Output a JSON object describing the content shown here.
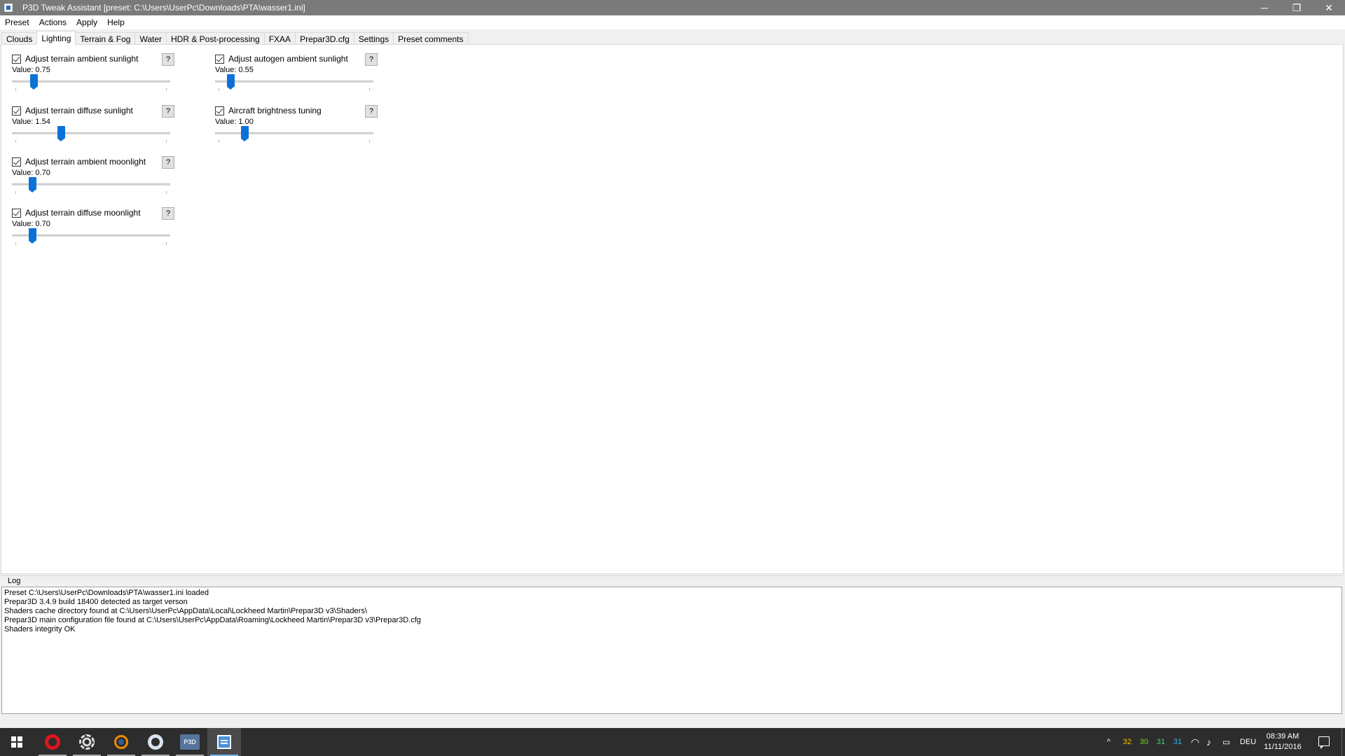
{
  "window": {
    "title": "P3D Tweak Assistant [preset: C:\\Users\\UserPc\\Downloads\\PTA\\wasser1.ini]",
    "controls": {
      "minimize": "─",
      "restore": "❐",
      "close": "✕"
    }
  },
  "menu": [
    "Preset",
    "Actions",
    "Apply",
    "Help"
  ],
  "tabs": [
    "Clouds",
    "Lighting",
    "Terrain & Fog",
    "Water",
    "HDR & Post-processing",
    "FXAA",
    "Prepar3D.cfg",
    "Settings",
    "Preset comments"
  ],
  "active_tab": "Lighting",
  "lighting": {
    "left_column": [
      {
        "label": "Adjust terrain ambient sunlight",
        "checked": true,
        "value_text": "Value: 0.75",
        "slider_fraction": 0.12,
        "help": "?"
      },
      {
        "label": "Adjust terrain diffuse sunlight",
        "checked": true,
        "value_text": "Value: 1.54",
        "slider_fraction": 0.3,
        "help": "?"
      },
      {
        "label": "Adjust terrain ambient moonlight",
        "checked": true,
        "value_text": "Value: 0.70",
        "slider_fraction": 0.11,
        "help": "?"
      },
      {
        "label": "Adjust terrain diffuse moonlight",
        "checked": true,
        "value_text": "Value: 0.70",
        "slider_fraction": 0.11,
        "help": "?"
      }
    ],
    "right_column": [
      {
        "label": "Adjust autogen ambient sunlight",
        "checked": true,
        "value_text": "Value: 0.55",
        "slider_fraction": 0.08,
        "help": "?"
      },
      {
        "label": "Aircraft brightness tuning",
        "checked": true,
        "value_text": "Value: 1.00",
        "slider_fraction": 0.17,
        "help": "?"
      }
    ]
  },
  "log": {
    "title": "Log",
    "lines": [
      "Preset C:\\Users\\UserPc\\Downloads\\PTA\\wasser1.ini loaded",
      "Prepar3D 3.4.9 build 18400 detected as target verson",
      "Shaders cache directory found at C:\\Users\\UserPc\\AppData\\Local\\Lockheed Martin\\Prepar3D v3\\Shaders\\",
      "Prepar3D main configuration file found at C:\\Users\\UserPc\\AppData\\Roaming\\Lockheed Martin\\Prepar3D v3\\Prepar3D.cfg",
      "Shaders integrity OK"
    ]
  },
  "taskbar": {
    "apps": [
      "start-icon",
      "opera-icon",
      "settings-gear-icon",
      "blender-icon",
      "steam-icon",
      "p3d-icon",
      "pta-icon"
    ],
    "p3d_label": "P3D",
    "tray_numbers": [
      {
        "text": "32",
        "color": "#f5c400"
      },
      {
        "text": "30",
        "color": "#7ed321"
      },
      {
        "text": "31",
        "color": "#3fd37a"
      },
      {
        "text": "31",
        "color": "#29b6f6"
      }
    ],
    "tray_chevron": "^",
    "language": "DEU",
    "time": "08:39 AM",
    "date": "11/11/2016"
  }
}
